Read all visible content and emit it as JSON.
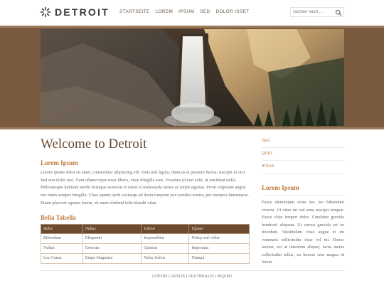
{
  "brand": {
    "name": "DETROIT"
  },
  "nav": {
    "items": [
      "STARTSEITE",
      "LOREM",
      "IPSUM",
      "SED",
      "DOLOR ISSET"
    ]
  },
  "search": {
    "placeholder": "Suchen nach ..."
  },
  "main": {
    "title": "Welcome to Detroit",
    "section_heading": "Lorem Ipsum",
    "paragraph": "Lorem ipsum dolor sit amet, consectetur adipiscing elit. Duis nisl ligula, rhoncus et posuere luctus, suscipit in orci. Sed non dolor nisl. Nam ullamcorper risus libero, vitae fringilla sem. Vivamus id erat velit, ut tincidunt nulla. Pellentesque habitant morbi tristique senectus et netus et malesuada fames ac turpis egestas. Proin vulputate augue nec enim semper fringilla. Class aptent taciti sociosqu ad litora torquent per conubia nostra, per inceptos himenaeos. Etiam placerat egestas lorem, sit amet eleifend felis blandit vitae.",
    "table_heading": "Bella Tabella",
    "table": {
      "headers": [
        "Bolor",
        "Nukus",
        "Udoso",
        "Elpuso"
      ],
      "rows": [
        [
          "Bibendum",
          "Eloquenti",
          "Impossiblus",
          "Nolep sed volter"
        ],
        [
          "Nukus",
          "Erwintu",
          "Quintus",
          "Imperatus"
        ],
        [
          "Loc Causa",
          "Empe Singulara",
          "Nelac Ichios",
          "Nunqui"
        ]
      ]
    }
  },
  "sidebar": {
    "links": [
      "SED",
      "QUID",
      "IPSUS"
    ],
    "heading": "Lorem Ipsum",
    "text": "Fusce elementum enim nec leo bibendum viverra. Ut vitae mi sed urna suscipit tempus. Fusce vitae tempor dolor. Curabitur gravida hendrerit aliquam. Ut cursus gravida est eu tincidunt. Vestibulum vitae augue et mi venenatis sollicitudin vitae vel mi. Donec laoreet, est ut interdum aliquet, lacus metus sollicitudin tellus, eu laoreet sem magna id lorem."
  },
  "footer": {
    "links": [
      "LOPOM",
      "URSUS",
      "VESTIBULUS",
      "INQUID"
    ],
    "separator": " | "
  },
  "colors": {
    "brand_brown": "#6b4a30",
    "accent_orange": "#c07a3e",
    "banner_bg": "#7a5a3f"
  },
  "icons": {
    "logo": "sun-burst-icon",
    "search": "magnifier-icon"
  }
}
